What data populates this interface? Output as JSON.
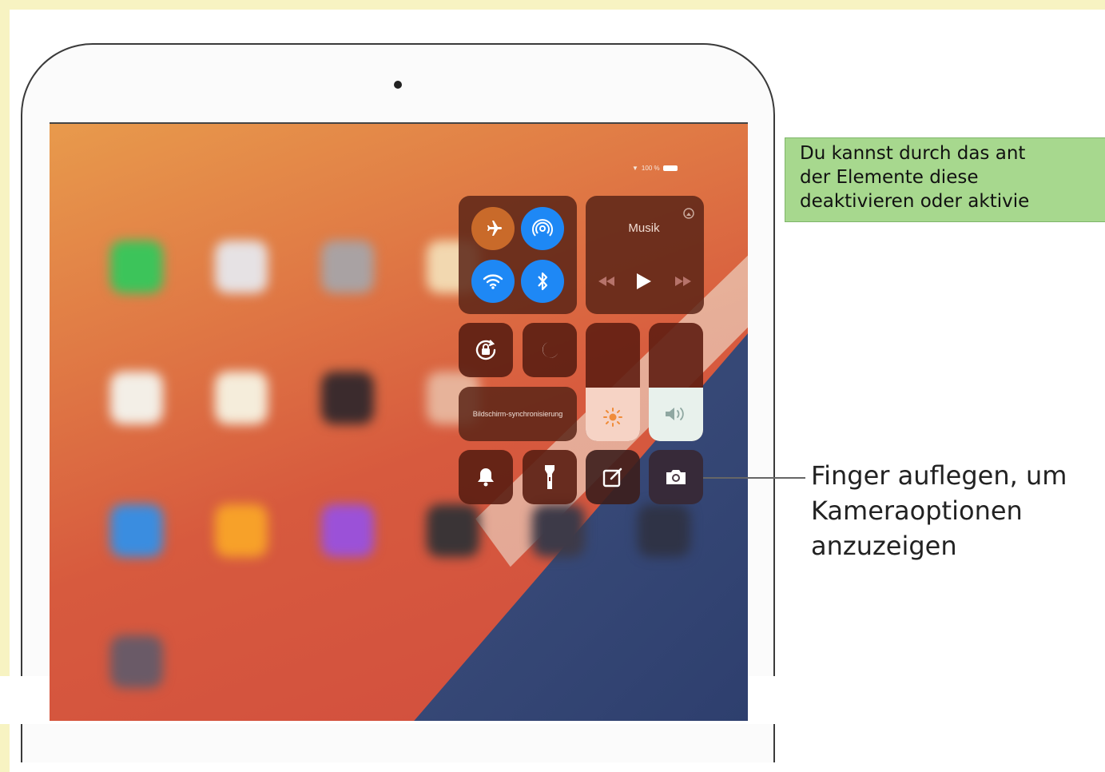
{
  "status_bar": {
    "battery": "100 %"
  },
  "control_center": {
    "connectivity": {
      "airplane_icon": "airplane-icon",
      "airdrop_icon": "airdrop-icon",
      "wifi_icon": "wifi-icon",
      "bluetooth_icon": "bluetooth-icon"
    },
    "music": {
      "label": "Musik",
      "prev_icon": "rewind-icon",
      "play_icon": "play-icon",
      "next_icon": "fast-forward-icon"
    },
    "rotation_lock_icon": "rotation-lock-icon",
    "do_not_disturb_icon": "moon-icon",
    "screen_mirroring_label": "Bildschirm-synchronisierung",
    "brightness_level": 0.45,
    "volume_level": 0.45,
    "bottom_row": [
      "bell-icon",
      "flashlight-icon",
      "notes-icon",
      "camera-icon"
    ]
  },
  "note_box": {
    "text_line1": "Du kannst durch das ant",
    "text_line2": "der Elemente diese",
    "text_line3": "deaktivieren oder aktivie"
  },
  "callout": {
    "line1": "Finger auflegen, um",
    "line2": "Kameraoptionen",
    "line3": "anzuzeigen"
  },
  "colors": {
    "accent_blue": "#1e88f5",
    "airplane_orange": "#c96a2a",
    "note_green": "#a7d88e",
    "frame_cream": "#f7f3c2"
  }
}
